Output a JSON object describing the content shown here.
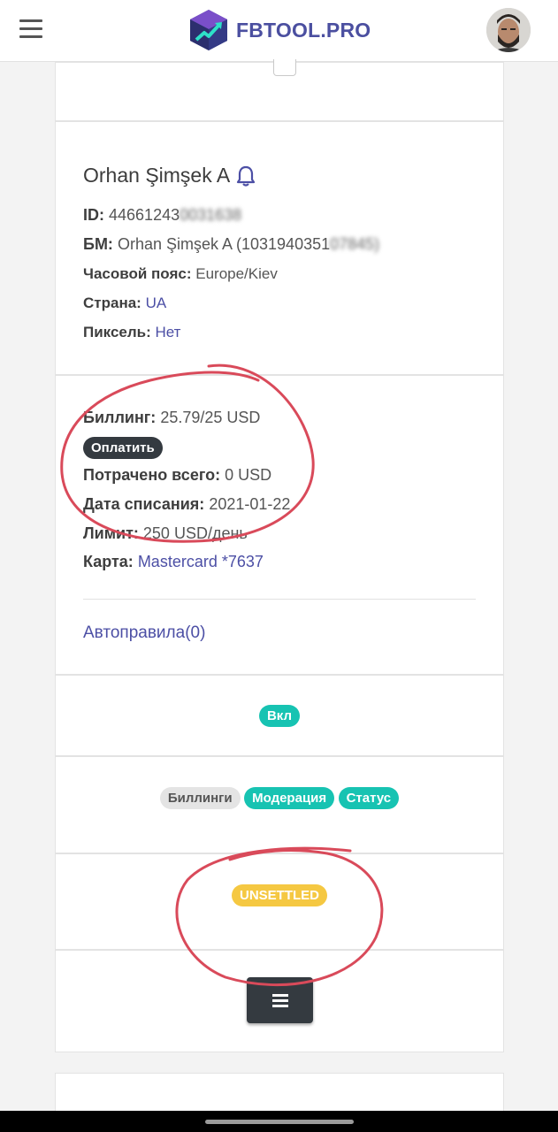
{
  "header": {
    "logo_text": "FBTOOL.PRO",
    "menu_icon": "hamburger-menu-icon",
    "avatar_alt": "user-avatar"
  },
  "account": {
    "name": "Orhan Şimşek A",
    "id_label": "ID:",
    "id_value": "44661243",
    "id_hidden": "0031638",
    "bm_label": "БМ:",
    "bm_value": "Orhan Şimşek A (1031940351",
    "bm_hidden": "07845)",
    "timezone_label": "Часовой пояс:",
    "timezone_value": "Europe/Kiev",
    "country_label": "Страна:",
    "country_value": "UA",
    "pixel_label": "Пиксель:",
    "pixel_value": "Нет"
  },
  "billing": {
    "billing_label": "Биллинг:",
    "billing_value": "25.79/25 USD",
    "pay_button": "Оплатить",
    "spent_label": "Потрачено всего:",
    "spent_value": "0 USD",
    "charge_date_label": "Дата списания:",
    "charge_date_value": "2021-01-22",
    "limit_label": "Лимит:",
    "limit_value": "250 USD/день",
    "card_label": "Карта:",
    "card_value": "Mastercard *7637",
    "autorules_link": "Автоправила(0)"
  },
  "status": {
    "enabled_badge": "Вкл"
  },
  "tags": [
    "Биллинги",
    "Модерация",
    "Статус"
  ],
  "settlement": {
    "badge": "UNSETTLED"
  },
  "colors": {
    "accent": "#4b4fa0",
    "teal": "#17c3b2",
    "dark": "#343a40",
    "yellow": "#f5c842",
    "annotation_red": "#d94a5a"
  }
}
